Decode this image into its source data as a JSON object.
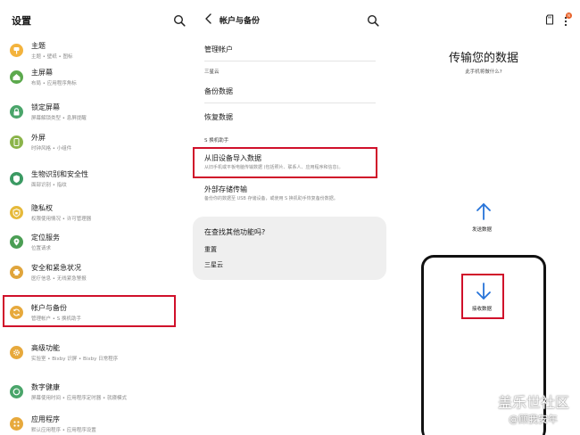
{
  "settings": {
    "title": "设置",
    "items": [
      {
        "title": "主题",
        "subtitle": "主题 • 壁纸 • 图标",
        "icon": "theme-icon",
        "color": "#f3b33d"
      },
      {
        "title": "主屏幕",
        "subtitle": "布局 • 应用程序角标",
        "icon": "home-icon",
        "color": "#5ca94d"
      },
      {
        "title": "锁定屏幕",
        "subtitle": "屏幕解锁类型 • 息屏提醒",
        "icon": "lock-icon",
        "color": "#4aa56a"
      },
      {
        "title": "外屏",
        "subtitle": "时钟风格 • 小组件",
        "icon": "cover-screen-icon",
        "color": "#8bb44a"
      },
      {
        "title": "生物识别和安全性",
        "subtitle": "面部识别 • 指纹",
        "icon": "shield-icon",
        "color": "#3b9a63"
      },
      {
        "title": "隐私权",
        "subtitle": "权限使用情况 • 许可管理器",
        "icon": "privacy-icon",
        "color": "#e6b93a"
      },
      {
        "title": "定位服务",
        "subtitle": "位置请求",
        "icon": "location-icon",
        "color": "#4b9e54"
      },
      {
        "title": "安全和紧急状况",
        "subtitle": "医疗信息 • 无线紧急警报",
        "icon": "emergency-icon",
        "color": "#e0a53c"
      },
      {
        "title": "帐户与备份",
        "subtitle": "管理帐户 • S 换机助手",
        "icon": "sync-icon",
        "color": "#e7a93c"
      },
      {
        "title": "高级功能",
        "subtitle": "实验室 • Bixby 识屏 • Bixby 日常程序",
        "icon": "gear-plus-icon",
        "color": "#e7a93c"
      },
      {
        "title": "数字健康",
        "subtitle": "屏幕使用时间 • 应用程序定时器 • 就寝模式",
        "icon": "wellbeing-icon",
        "color": "#4aa56a"
      },
      {
        "title": "应用程序",
        "subtitle": "默认应用程序 • 应用程序设置",
        "icon": "apps-icon",
        "color": "#e7a93c"
      }
    ]
  },
  "accounts": {
    "title": "帐户与备份",
    "manage": "管理帐户",
    "section_cloud": "三星云",
    "backup": "备份数据",
    "restore": "恢复数据",
    "section_switch": "S 换机助手",
    "import_title": "从旧设备导入数据",
    "import_sub": "从旧手机或平板电脑传输数据 (包括照片、联系人、应用程序和信息)。",
    "external_title": "外部存储传输",
    "external_sub": "备份你的数据至 USB 存储设备，或使用 S 换机助手恢复备份数据。",
    "card_title": "在查找其他功能吗?",
    "card_reset": "重置",
    "card_cloud": "三星云"
  },
  "transfer": {
    "title": "传输您的数据",
    "subtitle": "此手机将做什么?",
    "send": "发送数据",
    "receive": "接收数据",
    "badge": "N"
  },
  "watermark": {
    "line1": "盖乐世社区",
    "line2": "@顾我安年"
  },
  "colors": {
    "highlight": "#d0102a",
    "receive_accent": "#1a73e8"
  }
}
